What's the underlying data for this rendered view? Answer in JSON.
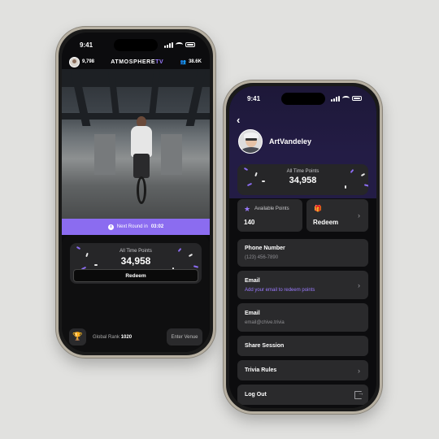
{
  "phone1": {
    "status": {
      "time": "9:41"
    },
    "topbar": {
      "points": "9,798",
      "brand_main": "ATMOSPHERE",
      "brand_accent": "TV",
      "followers": "38.6K"
    },
    "banner": {
      "label": "Next Round in ",
      "countdown": "03:02"
    },
    "points_card": {
      "label": "All Time Points",
      "value": "34,958",
      "redeem_label": "Redeem"
    },
    "bottom": {
      "rank_label": "Global Rank ",
      "rank_value": "1020",
      "enter_venue": "Enter Venue"
    }
  },
  "phone2": {
    "status": {
      "time": "9:41"
    },
    "profile": {
      "username": "ArtVandeley"
    },
    "all_time": {
      "label": "All Time Points",
      "value": "34,958"
    },
    "available": {
      "label": "Available Points",
      "value": "140"
    },
    "redeem": {
      "label": "Redeem"
    },
    "rows": {
      "phone": {
        "title": "Phone Number",
        "sub": "(123) 456-7890"
      },
      "email_action": {
        "title": "Email",
        "sub": "Add your email to redeem points"
      },
      "email": {
        "title": "Email",
        "sub": "email@chive.trivia"
      },
      "share": {
        "title": "Share Session"
      },
      "rules": {
        "title": "Trivia Rules"
      },
      "logout": {
        "title": "Log Out"
      }
    }
  },
  "colors": {
    "accent": "#8b6cf0",
    "background": "#e1e1df",
    "card": "#2a2a2c",
    "header": "#231c45"
  },
  "icons": [
    "back-arrow-icon",
    "star-icon",
    "gift-icon",
    "chevron-right-icon",
    "logout-icon",
    "trophy-icon",
    "clock-icon",
    "users-icon"
  ]
}
